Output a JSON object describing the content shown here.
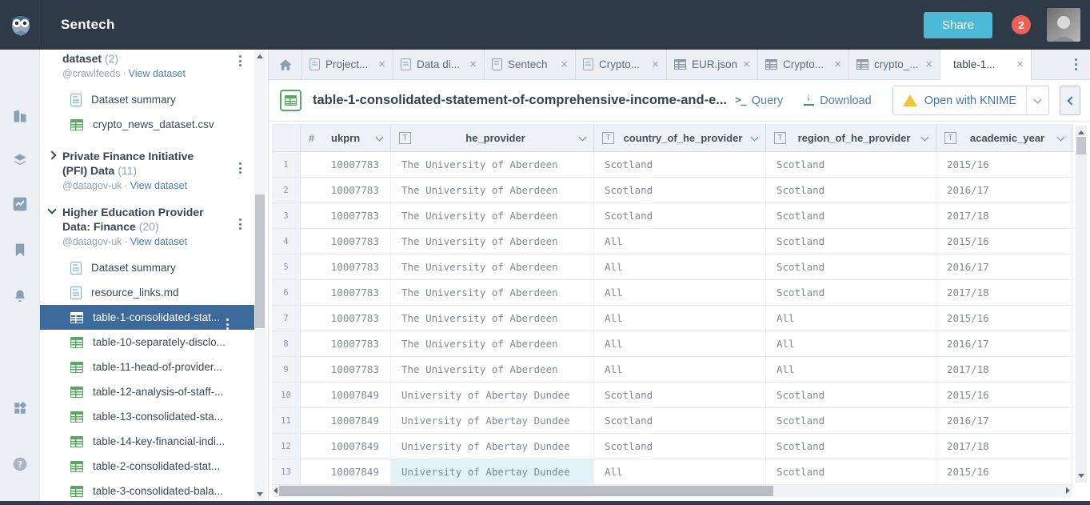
{
  "topbar": {
    "app_title": "Sentech",
    "share_label": "Share",
    "notification_count": "2"
  },
  "rail": {
    "icons": [
      "buildings",
      "layers",
      "analytics",
      "bookmark",
      "notifications",
      "apps",
      "help"
    ]
  },
  "sidebar": {
    "sections": [
      {
        "title": "dataset",
        "count": "(2)",
        "owner": "@crawlfeeds",
        "link": "View dataset",
        "children": [
          {
            "icon": "doc",
            "label": "Dataset summary"
          },
          {
            "icon": "table",
            "label": "crypto_news_dataset.csv"
          }
        ]
      },
      {
        "title": "Private Finance Initiative (PFI) Data",
        "count": "(11)",
        "owner": "@datagov-uk",
        "link": "View dataset",
        "children": []
      },
      {
        "title": "Higher Education Provider Data: Finance",
        "count": "(20)",
        "owner": "@datagov-uk",
        "link": "View dataset",
        "children": [
          {
            "icon": "doc",
            "label": "Dataset summary"
          },
          {
            "icon": "doc",
            "label": "resource_links.md"
          },
          {
            "icon": "table",
            "label": "table-1-consolidated-stat...",
            "state": "selected",
            "kebab": "show"
          },
          {
            "icon": "table",
            "label": "table-10-separately-disclo..."
          },
          {
            "icon": "table",
            "label": "table-11-head-of-provider..."
          },
          {
            "icon": "table",
            "label": "table-12-analysis-of-staff-..."
          },
          {
            "icon": "table",
            "label": "table-13-consolidated-sta..."
          },
          {
            "icon": "table",
            "label": "table-14-key-financial-indi..."
          },
          {
            "icon": "table",
            "label": "table-2-consolidated-stat..."
          },
          {
            "icon": "table",
            "label": "table-3-consolidated-bala..."
          }
        ]
      }
    ]
  },
  "tabs": {
    "items": [
      {
        "icon": "doc",
        "label": "Project..."
      },
      {
        "icon": "doc",
        "label": "Data di..."
      },
      {
        "icon": "scroll",
        "label": "Sentech"
      },
      {
        "icon": "doc",
        "label": "Crypto..."
      },
      {
        "icon": "tbl",
        "label": "EUR.json"
      },
      {
        "icon": "tbl",
        "label": "Crypto..."
      },
      {
        "icon": "tbl",
        "label": "crypto_..."
      },
      {
        "icon": "tblgreen",
        "label": "table-1...",
        "state": "active"
      }
    ]
  },
  "toolbar": {
    "title": "table-1-consolidated-statement-of-comprehensive-income-and-e...",
    "query_label": "Query",
    "download_label": "Download",
    "knime_label": "Open with KNIME"
  },
  "table": {
    "columns": [
      {
        "name": "ukprn",
        "type": "num"
      },
      {
        "name": "he_provider",
        "type": "text"
      },
      {
        "name": "country_of_he_provider",
        "type": "text"
      },
      {
        "name": "region_of_he_provider",
        "type": "text"
      },
      {
        "name": "academic_year",
        "type": "text"
      }
    ],
    "rows": [
      {
        "n": "1",
        "ukprn": "10007783",
        "provider": "The University of Aberdeen",
        "country": "Scotland",
        "region": "Scotland",
        "year": "2015/16"
      },
      {
        "n": "2",
        "ukprn": "10007783",
        "provider": "The University of Aberdeen",
        "country": "Scotland",
        "region": "Scotland",
        "year": "2016/17"
      },
      {
        "n": "3",
        "ukprn": "10007783",
        "provider": "The University of Aberdeen",
        "country": "Scotland",
        "region": "Scotland",
        "year": "2017/18"
      },
      {
        "n": "4",
        "ukprn": "10007783",
        "provider": "The University of Aberdeen",
        "country": "All",
        "region": "Scotland",
        "year": "2015/16"
      },
      {
        "n": "5",
        "ukprn": "10007783",
        "provider": "The University of Aberdeen",
        "country": "All",
        "region": "Scotland",
        "year": "2016/17"
      },
      {
        "n": "6",
        "ukprn": "10007783",
        "provider": "The University of Aberdeen",
        "country": "All",
        "region": "Scotland",
        "year": "2017/18"
      },
      {
        "n": "7",
        "ukprn": "10007783",
        "provider": "The University of Aberdeen",
        "country": "All",
        "region": "All",
        "year": "2015/16"
      },
      {
        "n": "8",
        "ukprn": "10007783",
        "provider": "The University of Aberdeen",
        "country": "All",
        "region": "All",
        "year": "2016/17"
      },
      {
        "n": "9",
        "ukprn": "10007783",
        "provider": "The University of Aberdeen",
        "country": "All",
        "region": "All",
        "year": "2017/18"
      },
      {
        "n": "10",
        "ukprn": "10007849",
        "provider": "University of Abertay Dundee",
        "country": "Scotland",
        "region": "Scotland",
        "year": "2015/16"
      },
      {
        "n": "11",
        "ukprn": "10007849",
        "provider": "University of Abertay Dundee",
        "country": "Scotland",
        "region": "Scotland",
        "year": "2016/17"
      },
      {
        "n": "12",
        "ukprn": "10007849",
        "provider": "University of Abertay Dundee",
        "country": "Scotland",
        "region": "Scotland",
        "year": "2017/18"
      },
      {
        "n": "13",
        "ukprn": "10007849",
        "provider": "University of Abertay Dundee",
        "country": "All",
        "region": "Scotland",
        "year": "2015/16",
        "hl": "hl"
      }
    ]
  },
  "colors": {
    "topbar": "#2e3a46",
    "accent_blue": "#4a81b5",
    "share_button": "#4cb9d7",
    "badge_red": "#e96157",
    "selected_item": "#3d6a9c",
    "green_table": "#58a95f",
    "highlight_cell": "#e2f3f8"
  }
}
